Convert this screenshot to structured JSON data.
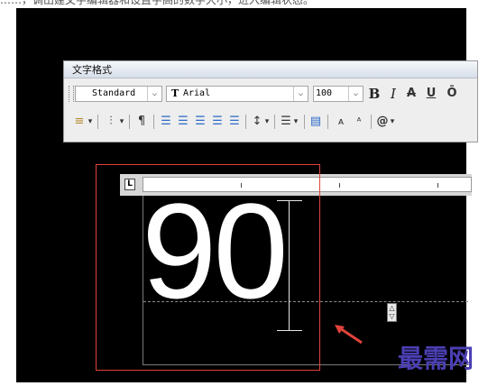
{
  "page_caption": "……，调出建文字编辑器和设置字高的数字大小，进入编辑状态。",
  "toolbar": {
    "title": "文字格式",
    "style_value": "Standard",
    "font_value": "Arial",
    "height_value": "100",
    "bold_label": "B",
    "italic_label": "I",
    "strike_label": "A",
    "underline_label": "U",
    "overline_label": "Ō",
    "at_label": "@"
  },
  "ruler": {
    "indent_marker": "L"
  },
  "editor": {
    "text": "90"
  },
  "watermark": "最需网",
  "colors": {
    "canvas": "#000000",
    "highlight_box": "#e0433b",
    "watermark": "#4b3fb3",
    "toolbar_bg": "#eeeeee"
  },
  "icons": [
    "text-style-icon",
    "dropdown-arrow-icon",
    "truetype-font-icon",
    "annotative-icon",
    "bold-icon",
    "italic-icon",
    "strikethrough-icon",
    "underline-icon",
    "overline-icon",
    "columns-icon",
    "justification-icon",
    "paragraph-icon",
    "align-left-icon",
    "align-center-icon",
    "align-right-icon",
    "justify-icon",
    "distribute-icon",
    "line-spacing-icon",
    "numbering-icon",
    "insert-field-icon",
    "uppercase-icon",
    "lowercase-icon",
    "symbol-icon",
    "resize-handle-icon",
    "arrow-icon"
  ]
}
